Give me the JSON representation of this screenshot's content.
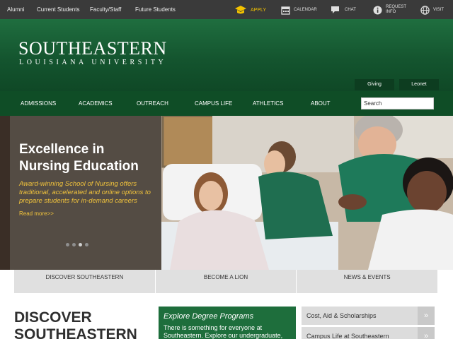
{
  "topbar": {
    "audiences": [
      "Alumni",
      "Current Students",
      "Faculty/Staff",
      "Future Students"
    ],
    "tools": {
      "apply": "APPLY",
      "calendar": "CALENDAR",
      "chat": "CHAT",
      "request_1": "REQUEST",
      "request_2": "INFO",
      "visit": "VISIT"
    }
  },
  "header": {
    "logo_main": "SOUTHEASTERN",
    "logo_sub": "LOUISIANA UNIVERSITY",
    "giving": "Giving",
    "leonet": "Leonet"
  },
  "nav": {
    "items": [
      "ADMISSIONS",
      "ACADEMICS",
      "OUTREACH",
      "CAMPUS LIFE",
      "ATHLETICS",
      "ABOUT"
    ],
    "search_value": "Search"
  },
  "hero": {
    "title": "Excellence in Nursing Education",
    "text": "Award-winning School of Nursing offers traditional, accelerated and online options to prepare students for in-demand careers",
    "more": "Read more>>",
    "slides": 4,
    "active_slide": 2
  },
  "tabs": [
    "DISCOVER SOUTHEASTERN",
    "BECOME A LION",
    "NEWS & EVENTS"
  ],
  "content": {
    "discover_title": "DISCOVER SOUTHEASTERN",
    "degree_title": "Explore Degree Programs",
    "degree_text": "There is something for everyone at Southeastern. Explore our undergraduate,",
    "links": [
      "Cost, Aid & Scholarships",
      "Campus Life at Southeastern"
    ],
    "arrow": "»"
  },
  "colors": {
    "brand_green": "#1f6e3f",
    "nav_green": "#0f4d26",
    "gold": "#f3c200",
    "topbar": "#3a3a3a"
  }
}
